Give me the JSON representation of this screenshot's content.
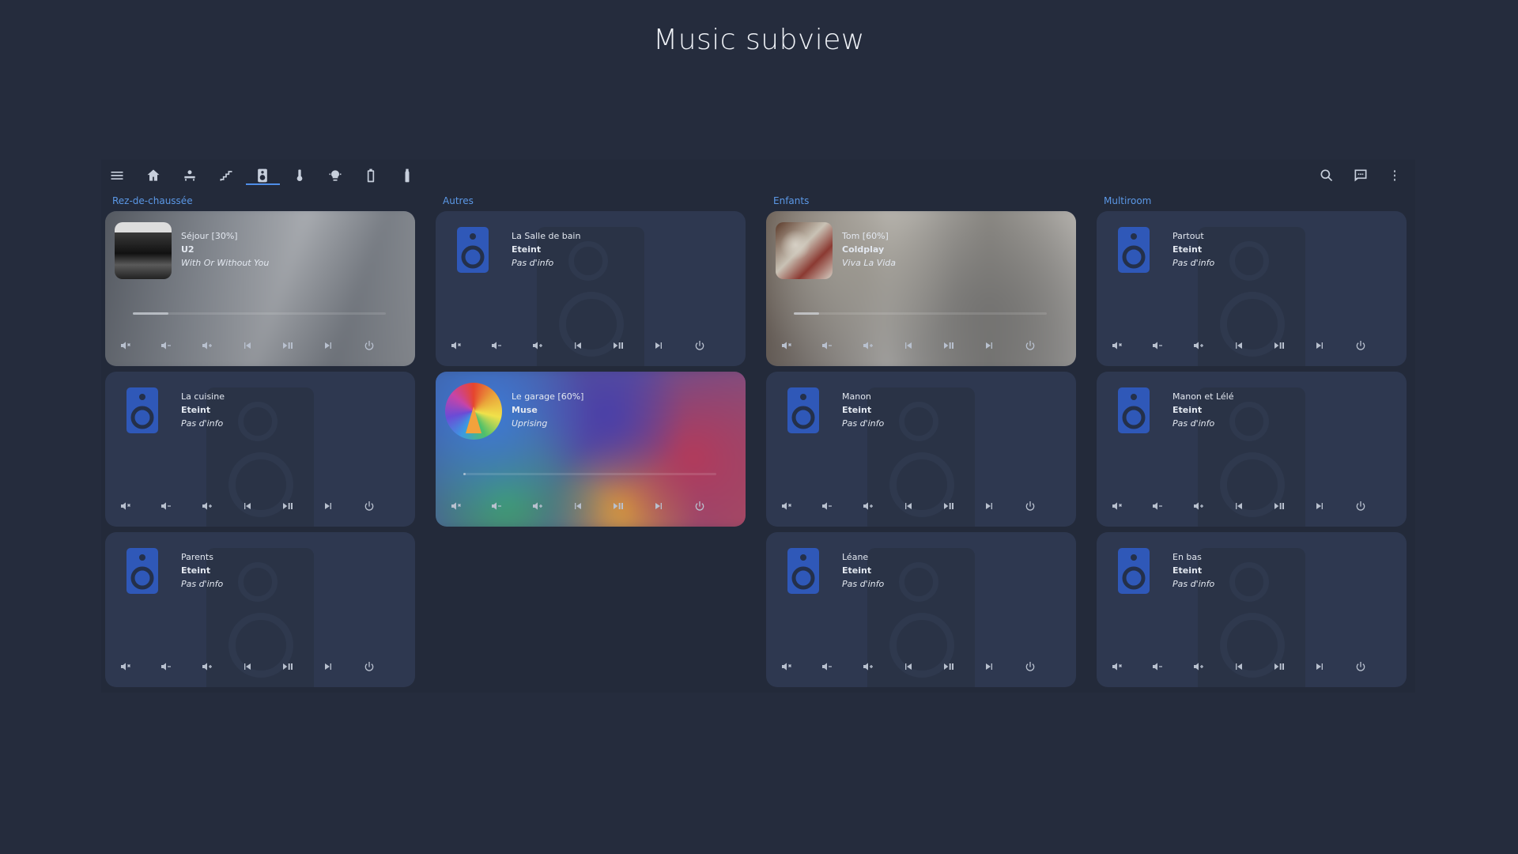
{
  "title": "Music subview",
  "colors": {
    "accent": "#5b98e6",
    "background": "#252c3d",
    "card": "#2e3850",
    "speaker": "#2f58b8"
  },
  "toolbar": {
    "left_icons": [
      "menu-icon",
      "home-icon",
      "sofa-icon",
      "stairs-icon",
      "speaker-icon",
      "thermometer-icon",
      "lamp-icon",
      "battery-icon",
      "bottle-icon"
    ],
    "right_icons": [
      "search-icon",
      "assist-icon",
      "more-icon"
    ],
    "active": "speaker-icon"
  },
  "columns": [
    "Rez-de-chaussée",
    "Autres",
    "Enfants",
    "Multiroom"
  ],
  "players": [
    {
      "col": 0,
      "row": 0,
      "name": "Séjour [30%]",
      "artist": "U2",
      "track": "With Or Without You",
      "art": "u2",
      "progress": 0.14
    },
    {
      "col": 0,
      "row": 1,
      "name": "La cuisine",
      "artist": "Eteint",
      "track": "Pas d'info",
      "art": "speaker"
    },
    {
      "col": 0,
      "row": 2,
      "name": "Parents",
      "artist": "Eteint",
      "track": "Pas d'info",
      "art": "speaker"
    },
    {
      "col": 1,
      "row": 0,
      "name": "La Salle de bain",
      "artist": "Eteint",
      "track": "Pas d'info",
      "art": "speaker"
    },
    {
      "col": 1,
      "row": 1,
      "name": "Le garage [60%]",
      "artist": "Muse",
      "track": "Uprising",
      "art": "muse",
      "progress": 0.01
    },
    {
      "col": 2,
      "row": 0,
      "name": "Tom [60%]",
      "artist": "Coldplay",
      "track": "Viva La Vida",
      "art": "cold",
      "progress": 0.1
    },
    {
      "col": 2,
      "row": 1,
      "name": "Manon",
      "artist": "Eteint",
      "track": "Pas d'info",
      "art": "speaker"
    },
    {
      "col": 2,
      "row": 2,
      "name": "Léane",
      "artist": "Eteint",
      "track": "Pas d'info",
      "art": "speaker"
    },
    {
      "col": 3,
      "row": 0,
      "name": "Partout",
      "artist": "Eteint",
      "track": "Pas d'info",
      "art": "speaker"
    },
    {
      "col": 3,
      "row": 1,
      "name": "Manon et Lélé",
      "artist": "Eteint",
      "track": "Pas d'info",
      "art": "speaker"
    },
    {
      "col": 3,
      "row": 2,
      "name": "En bas",
      "artist": "Eteint",
      "track": "Pas d'info",
      "art": "speaker"
    }
  ],
  "controls": [
    "mute-icon",
    "volume-down-icon",
    "volume-up-icon",
    "previous-icon",
    "play-pause-icon",
    "next-icon",
    "power-icon"
  ]
}
